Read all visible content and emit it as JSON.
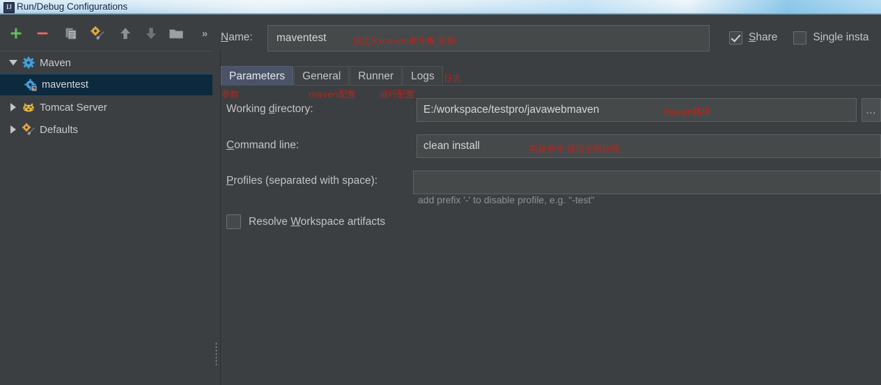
{
  "window": {
    "title": "Run/Debug Configurations",
    "icon": "intellij-idea-icon"
  },
  "toolbar": {
    "buttons": [
      {
        "name": "add-configuration-button",
        "icon": "plus-icon",
        "tooltip": "Add New Configuration"
      },
      {
        "name": "remove-configuration-button",
        "icon": "minus-icon",
        "tooltip": "Remove Configuration"
      },
      {
        "name": "copy-configuration-button",
        "icon": "copy-icon",
        "tooltip": "Copy Configuration"
      },
      {
        "name": "edit-templates-button",
        "icon": "gear-wrench-icon",
        "tooltip": "Edit Templates"
      },
      {
        "name": "move-up-button",
        "icon": "arrow-up-icon",
        "tooltip": "Move Up"
      },
      {
        "name": "move-down-button",
        "icon": "arrow-down-icon",
        "tooltip": "Move Down"
      },
      {
        "name": "create-folder-button",
        "icon": "folder-icon",
        "tooltip": "Create New Folder"
      }
    ],
    "overflow_label": "»"
  },
  "tree": {
    "nodes": [
      {
        "label": "Maven",
        "icon": "maven-gear-icon",
        "expanded": true,
        "level": 0,
        "selected": false
      },
      {
        "label": "maventest",
        "icon": "maven-run-config-icon",
        "expanded": null,
        "level": 1,
        "selected": true
      },
      {
        "label": "Tomcat Server",
        "icon": "tomcat-cat-icon",
        "expanded": false,
        "level": 0,
        "selected": false
      },
      {
        "label": "Defaults",
        "icon": "defaults-gear-wrench-icon",
        "expanded": false,
        "level": 0,
        "selected": false
      }
    ]
  },
  "name_row": {
    "label": "Name:",
    "label_mnemonic": "N",
    "value": "maventest",
    "annotation": "自定义maven命令集 名称"
  },
  "options": {
    "share": {
      "label": "Share",
      "mnemonic": "S",
      "checked": true
    },
    "single_instance": {
      "label": "Single insta",
      "mnemonic": "i",
      "checked": false
    }
  },
  "tabs": [
    {
      "label": "Parameters",
      "active": true,
      "annotation": "参数"
    },
    {
      "label": "General",
      "active": false,
      "annotation": "maven配置"
    },
    {
      "label": "Runner",
      "active": false,
      "annotation": "运行配置"
    },
    {
      "label": "Logs",
      "active": false,
      "annotation": "日志"
    }
  ],
  "form": {
    "working_directory": {
      "label_pre": "Working ",
      "label_mnemonic": "d",
      "label_post": "irectory:",
      "value": "E:/workspace/testpro/javawebmaven",
      "annotation": "maven路径",
      "browse_label": "..."
    },
    "command_line": {
      "label_pre": "",
      "label_mnemonic": "C",
      "label_post": "ommand line:",
      "value": "clean install",
      "annotation": "构建命令 使用空格分隔"
    },
    "profiles": {
      "label_pre": "",
      "label_mnemonic": "P",
      "label_post": "rofiles (separated with space):",
      "value": "",
      "hint": "add prefix '-' to disable profile, e.g. \"-test\""
    },
    "resolve_workspace": {
      "label_pre": "Resolve ",
      "label_mnemonic": "W",
      "label_post": "orkspace artifacts",
      "checked": false
    }
  },
  "colors": {
    "background": "#3C3F41",
    "field_background": "#45494A",
    "selection": "#0D293E",
    "active_tab": "#4B5368",
    "annotation_red": "#C4211A",
    "add_green": "#4CA64C",
    "remove_red": "#C75450"
  }
}
